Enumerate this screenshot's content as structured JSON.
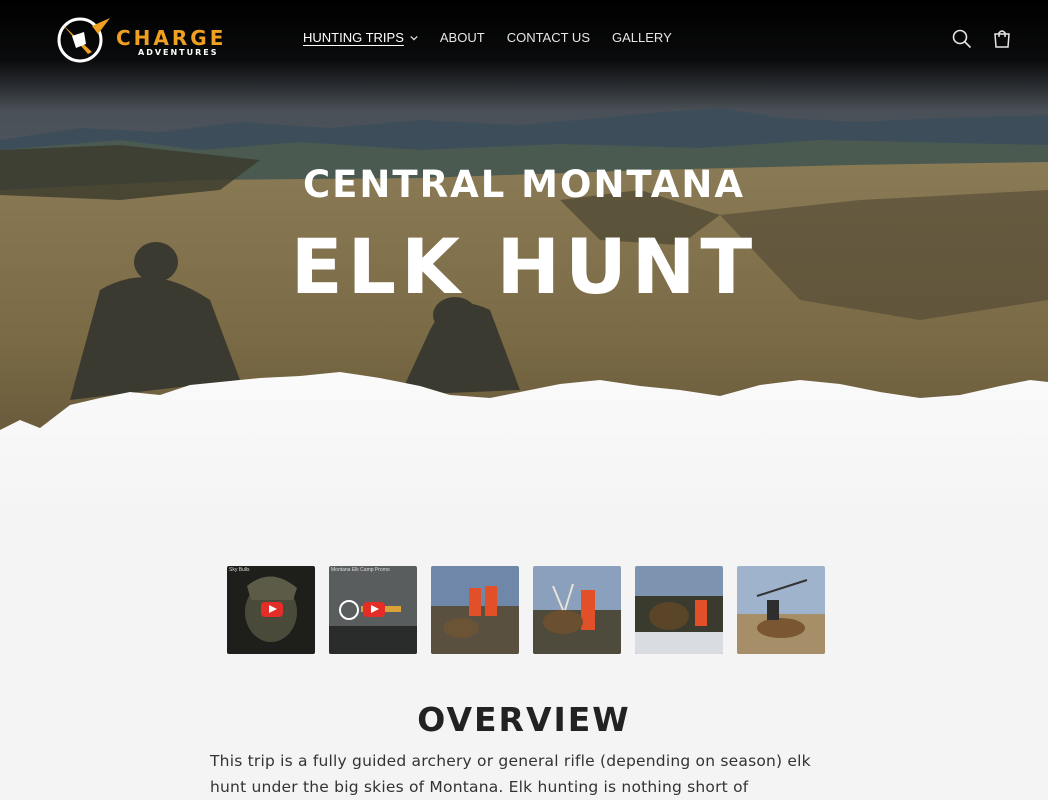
{
  "brand": {
    "name": "CHARGE",
    "tagline": "ADVENTURES",
    "accent_color": "#f0a020"
  },
  "nav": {
    "items": [
      {
        "label": "HUNTING TRIPS",
        "has_dropdown": true,
        "active": true
      },
      {
        "label": "ABOUT"
      },
      {
        "label": "CONTACT US"
      },
      {
        "label": "GALLERY"
      }
    ],
    "icons": [
      "search-icon",
      "cart-icon"
    ]
  },
  "hero": {
    "title_line_1": "CENTRAL MONTANA",
    "title_line_2": "ELK HUNT"
  },
  "gallery": {
    "thumbnails": [
      {
        "type": "video",
        "caption": "Sky Bulls"
      },
      {
        "type": "video",
        "caption": "Montana Elk Camp Promo"
      },
      {
        "type": "photo"
      },
      {
        "type": "photo"
      },
      {
        "type": "photo"
      },
      {
        "type": "photo"
      }
    ]
  },
  "overview": {
    "title": "OVERVIEW",
    "text": "This trip is a fully guided archery or general rifle (depending on season) elk hunt under the big skies of Montana. Elk hunting is nothing short of spectacular and"
  }
}
